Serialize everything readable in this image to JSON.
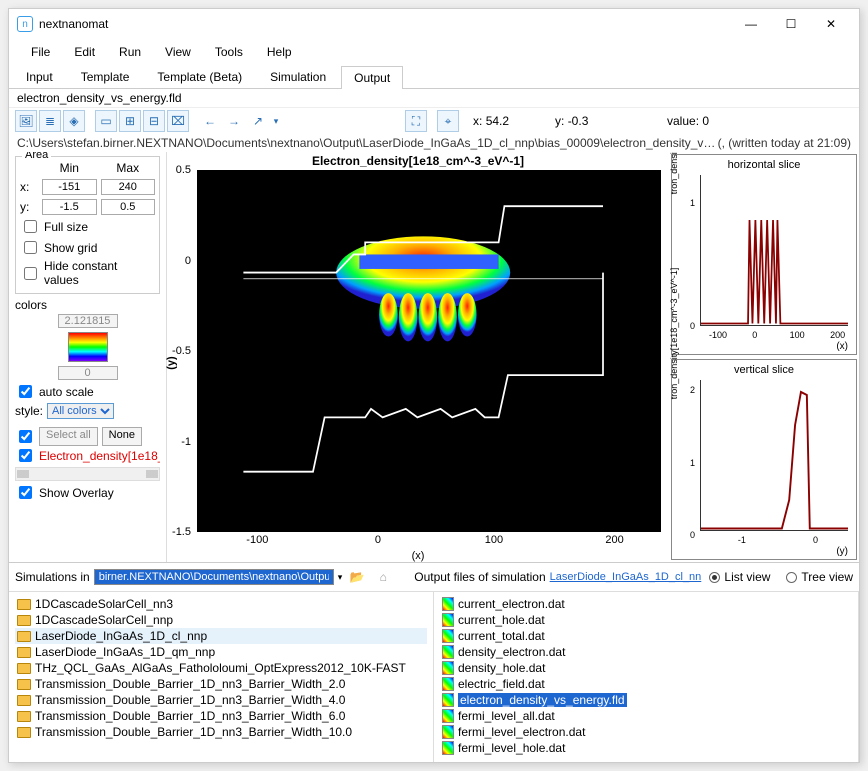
{
  "titlebar": {
    "app_name": "nextnanomat"
  },
  "menu": [
    "File",
    "Edit",
    "Run",
    "View",
    "Tools",
    "Help"
  ],
  "main_tabs": [
    "Input",
    "Template",
    "Template (Beta)",
    "Simulation",
    "Output"
  ],
  "active_tab_index": 4,
  "open_file": "electron_density_vs_energy.fld",
  "file_path": "C:\\Users\\stefan.birner.NEXTNANO\\Documents\\nextnano\\Output\\LaserDiode_InGaAs_1D_cl_nnp\\bias_00009\\electron_density_vs_energy.fld",
  "file_meta": "(, (written today at 21:09)",
  "cursor": {
    "x_label": "x:",
    "x_val": "54.2",
    "y_label": "y:",
    "y_val": "-0.3",
    "v_label": "value:",
    "v_val": "0"
  },
  "area": {
    "title": "Area",
    "min_lbl": "Min",
    "max_lbl": "Max",
    "x_lbl": "x:",
    "x_min": "-151",
    "x_max": "240",
    "y_lbl": "y:",
    "y_min": "-1.5",
    "y_max": "0.5",
    "full_size": "Full size",
    "show_grid": "Show grid",
    "hide_const": "Hide constant values"
  },
  "colors": {
    "title": "colors",
    "top_val": "2.121815",
    "bot_val": "0",
    "auto_scale": "auto scale",
    "style_lbl": "style:",
    "style_val": "All colors"
  },
  "series": {
    "select_all": "Select all",
    "none": "None",
    "item": "Electron_density[1e18_",
    "show_overlay": "Show Overlay"
  },
  "chart_data": {
    "main": {
      "type": "heatmap",
      "title": "Electron_density[1e18_cm^-3_eV^-1]",
      "xlabel": "(x)",
      "ylabel": "(y)",
      "xlim": [
        -151,
        240
      ],
      "ylim": [
        -1.5,
        0.5
      ],
      "x_ticks": [
        "-100",
        "0",
        "100",
        "200"
      ],
      "y_ticks": [
        "0.5",
        "0",
        "-0.5",
        "-1",
        "-1.5"
      ]
    },
    "horizontal": {
      "type": "line",
      "title": "horizontal slice",
      "ylabel": "tron_density[1e18_cm^-3_eV^-1]",
      "xlabel": "(x)",
      "xlim": [
        -151,
        240
      ],
      "ylim": [
        0,
        1.2
      ],
      "x_ticks": [
        "-100",
        "0",
        "100",
        "200"
      ],
      "y_ticks": [
        "0",
        "1"
      ],
      "peak_region_x": [
        -10,
        55
      ],
      "peak_value": 0.82
    },
    "vertical": {
      "type": "line",
      "title": "vertical slice",
      "ylabel": "tron_density[1e18_cm^-3_eV^-1]",
      "xlabel": "(y)",
      "xlim": [
        -1.5,
        0.5
      ],
      "ylim": [
        0,
        2.2
      ],
      "x_ticks": [
        "-1",
        "0"
      ],
      "y_ticks": [
        "0",
        "1",
        "2"
      ],
      "peak_x": -0.05,
      "peak_value": 2.05
    }
  },
  "bottom": {
    "sim_in_lbl": "Simulations in",
    "sim_path": "birner.NEXTNANO\\Documents\\nextnano\\Output",
    "out_lbl": "Output files of simulation",
    "out_link": "LaserDiode_InGaAs_1D_cl_nn",
    "list_view": "List view",
    "tree_view": "Tree view",
    "sims": [
      "1DCascadeSolarCell_nn3",
      "1DCascadeSolarCell_nnp",
      "LaserDiode_InGaAs_1D_cl_nnp",
      "LaserDiode_InGaAs_1D_qm_nnp",
      "THz_QCL_GaAs_AlGaAs_Fathololoumi_OptExpress2012_10K-FAST",
      "Transmission_Double_Barrier_1D_nn3_Barrier_Width_2.0",
      "Transmission_Double_Barrier_1D_nn3_Barrier_Width_4.0",
      "Transmission_Double_Barrier_1D_nn3_Barrier_Width_6.0",
      "Transmission_Double_Barrier_1D_nn3_Barrier_Width_10.0"
    ],
    "sel_sim_index": 2,
    "files": [
      "current_electron.dat",
      "current_hole.dat",
      "current_total.dat",
      "density_electron.dat",
      "density_hole.dat",
      "electric_field.dat",
      "electron_density_vs_energy.fld",
      "fermi_level_all.dat",
      "fermi_level_electron.dat",
      "fermi_level_hole.dat"
    ],
    "sel_file_index": 6
  }
}
